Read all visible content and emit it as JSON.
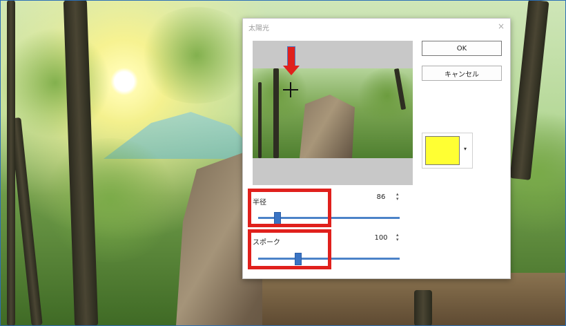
{
  "dialog": {
    "title": "太陽光",
    "close_glyph": "×",
    "ok_label": "OK",
    "cancel_label": "キャンセル"
  },
  "color": {
    "selected": "#ffff33",
    "dropdown_glyph": "▾",
    "icon": "chevron-down-icon"
  },
  "sliders": [
    {
      "label": "半径",
      "value": "86",
      "level_fraction": 0.13
    },
    {
      "label": "スポーク",
      "value": "100",
      "level_fraction": 0.28
    }
  ],
  "spin_glyph_up": "▴",
  "spin_glyph_down": "▾",
  "annotation_color": "#e0201c",
  "accent": "#4b82c8"
}
